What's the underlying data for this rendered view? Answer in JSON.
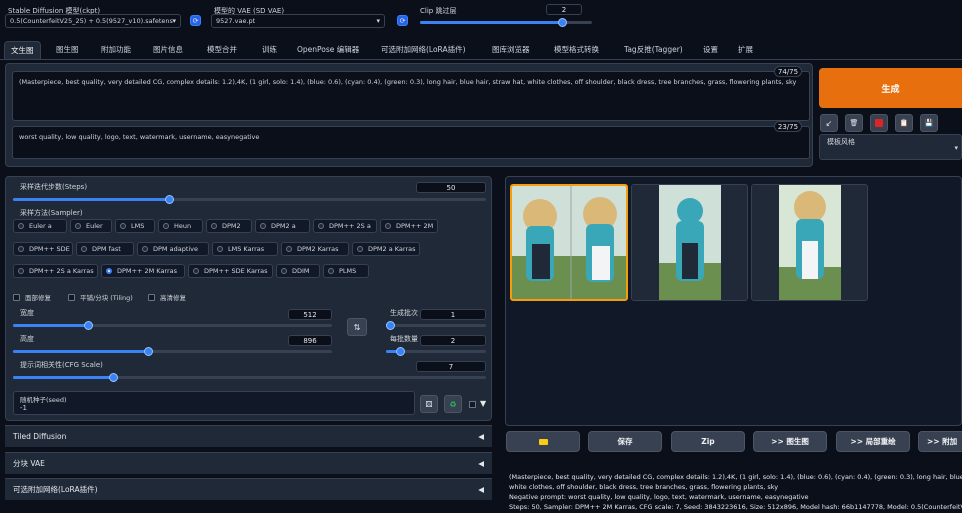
{
  "top": {
    "ckpt_label": "Stable Diffusion 模型(ckpt)",
    "ckpt_value": "0.5(CounterfeitV25_25) + 0.5(9527_v10).safetens",
    "vae_label": "模型的 VAE (SD VAE)",
    "vae_value": "9527.vae.pt",
    "clip_label": "Clip 跳过层",
    "clip_value": "2",
    "clip_fraction": 0.83
  },
  "tabs": [
    "文生图",
    "图生图",
    "附加功能",
    "图片信息",
    "模型合并",
    "训练",
    "OpenPose 编辑器",
    "可选附加网络(LoRA插件)",
    "图库浏览器",
    "模型格式转换",
    "Tag反推(Tagger)",
    "设置",
    "扩展"
  ],
  "prompt": {
    "positive": "(Masterpiece, best quality, very detailed CG, complex details: 1.2),4K, (1 girl, solo: 1.4), (blue: 0.6), (cyan: 0.4), (green: 0.3), long hair, blue hair, straw hat, white clothes, off shoulder, black dress, tree branches, grass, flowering plants, sky",
    "positive_count": "74/75",
    "negative": "worst quality, low quality, logo, text, watermark, username, easynegative",
    "negative_count": "23/75"
  },
  "generate_label": "生成",
  "style_label": "模板风格",
  "steps": {
    "label": "采样迭代步数(Steps)",
    "value": "50",
    "fraction": 0.33
  },
  "sampler": {
    "label": "采样方法(Sampler)",
    "items": [
      "Euler a",
      "Euler",
      "LMS",
      "Heun",
      "DPM2",
      "DPM2 a",
      "DPM++ 2S a",
      "DPM++ 2M",
      "DPM++ SDE",
      "DPM fast",
      "DPM adaptive",
      "LMS Karras",
      "DPM2 Karras",
      "DPM2 a Karras",
      "DPM++ 2S a Karras",
      "DPM++ 2M Karras",
      "DPM++ SDE Karras",
      "DDIM",
      "PLMS"
    ],
    "selected": "DPM++ 2M Karras"
  },
  "checks": [
    "面部修复",
    "平铺/分块 (Tiling)",
    "高清修复"
  ],
  "width": {
    "label": "宽度",
    "value": "512",
    "fraction": 0.2
  },
  "height": {
    "label": "高度",
    "value": "896",
    "fraction": 0.42
  },
  "batch_count": {
    "label": "生成批次",
    "value": "1",
    "fraction": 0.02
  },
  "batch_size": {
    "label": "每批数量",
    "value": "2",
    "fraction": 0.12
  },
  "cfg": {
    "label": "提示词相关性(CFG Scale)",
    "value": "7",
    "fraction": 0.21
  },
  "seed": {
    "label": "随机种子(seed)",
    "value": "-1"
  },
  "accordions": [
    "Tiled Diffusion",
    "分块 VAE",
    "可选附加网络(LoRA插件)"
  ],
  "actions": [
    "保存",
    "Zip",
    ">> 图生图",
    ">> 局部重绘",
    ">> 附加"
  ],
  "info": {
    "line1": "(Masterpiece, best quality, very detailed CG, complex details: 1.2),4K, (1 girl, solo: 1.4), (blue: 0.6), (cyan: 0.4), (green: 0.3), long hair, blue hair, straw hat,",
    "line2": "white clothes, off shoulder, black dress, tree branches, grass, flowering plants, sky",
    "line3": "Negative prompt: worst quality, low quality, logo, text, watermark, username, easynegative",
    "line4": "Steps: 50, Sampler: DPM++ 2M Karras, CFG scale: 7, Seed: 3843223616, Size: 512x896, Model hash: 66b1147778, Model: 0.5(CounterfeitV25_25) +"
  },
  "colors": {
    "accent": "#3b82f6",
    "generate": "#e86f0e",
    "bg": "#0b0f19",
    "panel": "#1f2937"
  }
}
